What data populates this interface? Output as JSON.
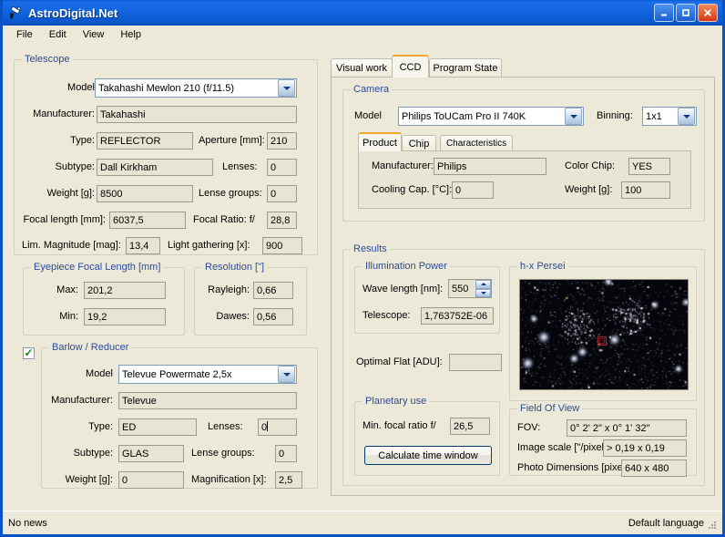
{
  "window": {
    "title": "AstroDigital.Net",
    "app_icon": "telescope-icon",
    "minimize_label": "_",
    "maximize_label": "□",
    "close_label": "✕"
  },
  "menubar": {
    "items": [
      "File",
      "Edit",
      "View",
      "Help"
    ]
  },
  "telescope": {
    "caption": "Telescope",
    "model_label": "Model",
    "model_value": "Takahashi Mewlon 210 (f/11.5)",
    "manufacturer_label": "Manufacturer:",
    "manufacturer_value": "Takahashi",
    "type_label": "Type:",
    "type_value": "REFLECTOR",
    "aperture_label": "Aperture [mm]:",
    "aperture_value": "210",
    "subtype_label": "Subtype:",
    "subtype_value": "Dall Kirkham",
    "lenses_label": "Lenses:",
    "lenses_value": "0",
    "weight_label": "Weight [g]:",
    "weight_value": "8500",
    "lense_groups_label": "Lense groups:",
    "lense_groups_value": "0",
    "focal_length_label": "Focal length [mm]:",
    "focal_length_value": "6037,5",
    "focal_ratio_label": "Focal Ratio:  f/",
    "focal_ratio_value": "28,8",
    "lim_magnitude_label": "Lim. Magnitude [mag]:",
    "lim_magnitude_value": "13,4",
    "light_gathering_label": "Light gathering [x]:",
    "light_gathering_value": "900"
  },
  "eyepiece": {
    "caption": "Eyepiece Focal Length [mm]",
    "max_label": "Max:",
    "max_value": "201,2",
    "min_label": "Min:",
    "min_value": "19,2"
  },
  "resolution": {
    "caption": "Resolution [\"]",
    "rayleigh_label": "Rayleigh:",
    "rayleigh_value": "0,66",
    "dawes_label": "Dawes:",
    "dawes_value": "0,56"
  },
  "barlow": {
    "caption": "Barlow / Reducer",
    "enabled": true,
    "model_label": "Model",
    "model_value": "Televue Powermate 2,5x",
    "manufacturer_label": "Manufacturer:",
    "manufacturer_value": "Televue",
    "type_label": "Type:",
    "type_value": "ED",
    "lenses_label": "Lenses:",
    "lenses_value": "0",
    "subtype_label": "Subtype:",
    "subtype_value": "GLAS",
    "lense_groups_label": "Lense groups:",
    "lense_groups_value": "0",
    "weight_label": "Weight [g]:",
    "weight_value": "0",
    "magnification_label": "Magnification [x]:",
    "magnification_value": "2,5"
  },
  "main_tabs": {
    "items": [
      "Visual work",
      "CCD",
      "Program State"
    ],
    "active": "CCD"
  },
  "camera": {
    "caption": "Camera",
    "model_label": "Model",
    "model_value": "Philips ToUCam Pro II 740K",
    "binning_label": "Binning:",
    "binning_value": "1x1",
    "tabs": {
      "items": [
        "Product",
        "Chip",
        "Characteristics"
      ],
      "active": "Product"
    },
    "manufacturer_label": "Manufacturer:",
    "manufacturer_value": "Philips",
    "color_chip_label": "Color Chip:",
    "color_chip_value": "YES",
    "cooling_label": "Cooling Cap. [°C]:",
    "cooling_value": "0",
    "weight_label": "Weight [g]:",
    "weight_value": "100"
  },
  "results": {
    "caption": "Results",
    "illumination": {
      "caption": "Illumination Power",
      "wavelength_label": "Wave length [nm]:",
      "wavelength_value": "550",
      "telescope_label": "Telescope:",
      "telescope_value": "1,763752E-06"
    },
    "optimal_flat_label": "Optimal Flat [ADU]:",
    "optimal_flat_value": "",
    "planetary": {
      "caption": "Planetary use",
      "min_focal_ratio_label": "Min. focal ratio f/",
      "min_focal_ratio_value": "26,5",
      "calculate_button": "Calculate time window"
    },
    "preview": {
      "caption": "h-x Persei"
    },
    "fov": {
      "caption": "Field Of View",
      "fov_label": "FOV:",
      "fov_value": "0° 2' 2\"  x 0° 1' 32\"",
      "image_scale_label": "Image scale [\"/pixel]:",
      "image_scale_value": "> 0,19 x 0,19",
      "photo_dim_label": "Photo Dimensions [pixel]:",
      "photo_dim_value": "640 x 480"
    }
  },
  "statusbar": {
    "news": "No news",
    "language": "Default language"
  },
  "colors": {
    "titlebar": "#0b57cc",
    "face": "#ece9d8",
    "field": "#e7e4d4",
    "caption_text": "#2b4b9b",
    "tab_accent": "#f0a92e"
  }
}
